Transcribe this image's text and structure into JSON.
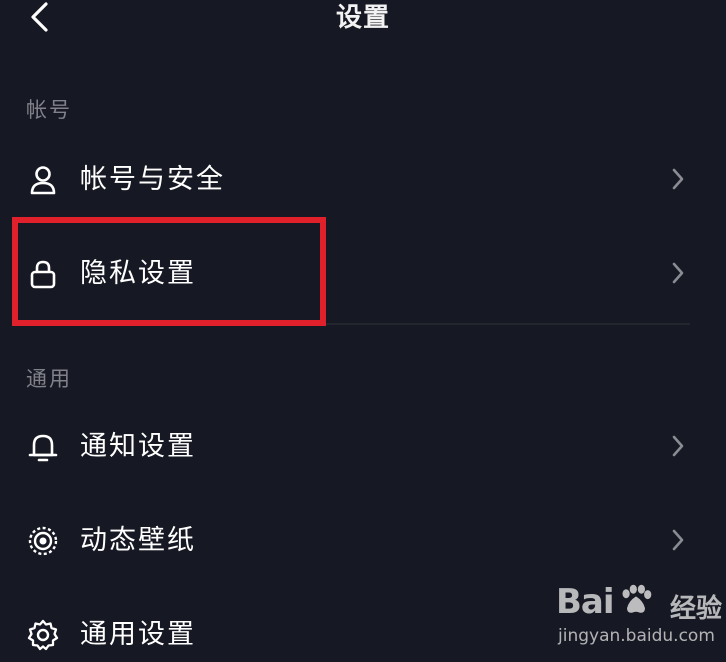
{
  "header": {
    "title": "设置",
    "back_icon": "chevron-left-icon"
  },
  "sections": [
    {
      "label": "帐号",
      "items": [
        {
          "label": "帐号与安全",
          "icon": "user-icon"
        },
        {
          "label": "隐私设置",
          "icon": "lock-icon",
          "highlighted": true
        }
      ]
    },
    {
      "label": "通用",
      "items": [
        {
          "label": "通知设置",
          "icon": "bell-icon"
        },
        {
          "label": "动态壁纸",
          "icon": "live-wallpaper-icon"
        },
        {
          "label": "通用设置",
          "icon": "gear-icon"
        }
      ]
    }
  ],
  "highlight_color": "#e0202a",
  "background_color": "#161823",
  "watermark": {
    "logo": "Bai百度",
    "brand_suffix": "经验",
    "url": "jingyan.baidu.com"
  }
}
